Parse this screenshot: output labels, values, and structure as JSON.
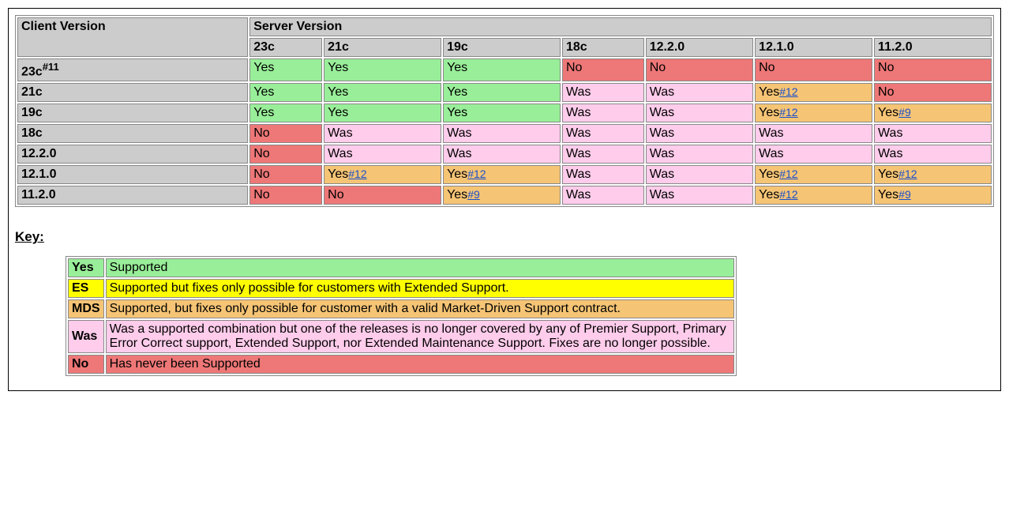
{
  "colors": {
    "yes": "#99ee99",
    "no": "#ee7777",
    "was": "#ffcceb",
    "mds": "#f5c475",
    "es": "#ffff00",
    "header": "#cccccc"
  },
  "notes": {
    "11": "#11",
    "12": "#12",
    "9": "#9"
  },
  "matrix": {
    "clientHeader": "Client Version",
    "serverHeader": "Server Version",
    "serverVersions": [
      "23c",
      "21c",
      "19c",
      "18c",
      "12.2.0",
      "12.1.0",
      "11.2.0"
    ],
    "rows": [
      {
        "client": "23c",
        "clientNote": "#11",
        "cells": [
          {
            "t": "Yes",
            "s": "yes"
          },
          {
            "t": "Yes",
            "s": "yes"
          },
          {
            "t": "Yes",
            "s": "yes"
          },
          {
            "t": "No",
            "s": "no"
          },
          {
            "t": "No",
            "s": "no"
          },
          {
            "t": "No",
            "s": "no"
          },
          {
            "t": "No",
            "s": "no"
          }
        ]
      },
      {
        "client": "21c",
        "cells": [
          {
            "t": "Yes",
            "s": "yes"
          },
          {
            "t": "Yes",
            "s": "yes"
          },
          {
            "t": "Yes",
            "s": "yes"
          },
          {
            "t": "Was",
            "s": "was"
          },
          {
            "t": "Was",
            "s": "was"
          },
          {
            "t": "Yes",
            "s": "mds",
            "note": "#12"
          },
          {
            "t": "No",
            "s": "no"
          }
        ]
      },
      {
        "client": "19c",
        "cells": [
          {
            "t": "Yes",
            "s": "yes"
          },
          {
            "t": "Yes",
            "s": "yes"
          },
          {
            "t": "Yes",
            "s": "yes"
          },
          {
            "t": "Was",
            "s": "was"
          },
          {
            "t": "Was",
            "s": "was"
          },
          {
            "t": "Yes",
            "s": "mds",
            "note": "#12"
          },
          {
            "t": "Yes",
            "s": "mds",
            "note": "#9"
          }
        ]
      },
      {
        "client": "18c",
        "cells": [
          {
            "t": "No",
            "s": "no"
          },
          {
            "t": "Was",
            "s": "was"
          },
          {
            "t": "Was",
            "s": "was"
          },
          {
            "t": "Was",
            "s": "was"
          },
          {
            "t": "Was",
            "s": "was"
          },
          {
            "t": "Was",
            "s": "was"
          },
          {
            "t": "Was",
            "s": "was"
          }
        ]
      },
      {
        "client": "12.2.0",
        "cells": [
          {
            "t": "No",
            "s": "no"
          },
          {
            "t": "Was",
            "s": "was"
          },
          {
            "t": "Was",
            "s": "was"
          },
          {
            "t": "Was",
            "s": "was"
          },
          {
            "t": "Was",
            "s": "was"
          },
          {
            "t": "Was",
            "s": "was"
          },
          {
            "t": "Was",
            "s": "was"
          }
        ]
      },
      {
        "client": "12.1.0",
        "cells": [
          {
            "t": "No",
            "s": "no"
          },
          {
            "t": "Yes",
            "s": "mds",
            "note": "#12"
          },
          {
            "t": "Yes",
            "s": "mds",
            "note": "#12"
          },
          {
            "t": "Was",
            "s": "was"
          },
          {
            "t": "Was",
            "s": "was"
          },
          {
            "t": "Yes",
            "s": "mds",
            "note": "#12"
          },
          {
            "t": "Yes",
            "s": "mds",
            "note": "#12"
          }
        ]
      },
      {
        "client": "11.2.0",
        "cells": [
          {
            "t": "No",
            "s": "no"
          },
          {
            "t": "No",
            "s": "no"
          },
          {
            "t": "Yes",
            "s": "mds",
            "note": "#9"
          },
          {
            "t": "Was",
            "s": "was"
          },
          {
            "t": "Was",
            "s": "was"
          },
          {
            "t": "Yes",
            "s": "mds",
            "note": "#12"
          },
          {
            "t": "Yes",
            "s": "mds",
            "note": "#9"
          }
        ]
      }
    ]
  },
  "keyHeading": "Key:",
  "key": [
    {
      "label": "Yes",
      "s": "yes",
      "desc": "Supported"
    },
    {
      "label": "ES",
      "s": "es",
      "desc": "Supported but fixes only possible for customers with Extended Support."
    },
    {
      "label": "MDS",
      "s": "mds",
      "desc": "Supported, but fixes only possible for customer with a valid Market-Driven Support contract."
    },
    {
      "label": "Was",
      "s": "was",
      "desc": "Was a supported combination but one of the releases is no longer covered by any of Premier Support, Primary Error Correct support, Extended Support, nor Extended Maintenance Support. Fixes are no longer possible."
    },
    {
      "label": "No",
      "s": "no",
      "desc": "Has never been Supported"
    }
  ]
}
